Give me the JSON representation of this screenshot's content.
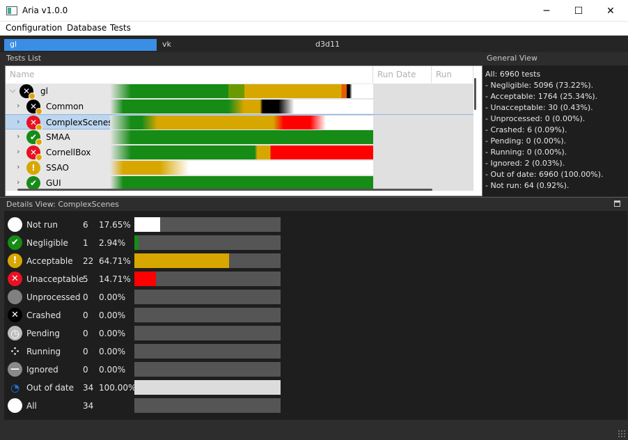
{
  "window": {
    "title": "Aria v1.0.0",
    "controls": {
      "minimize": "─",
      "maximize": "☐",
      "close": "✕"
    }
  },
  "menu": {
    "items": [
      "Configuration",
      "Database",
      "Tests"
    ]
  },
  "backends": {
    "tabs": [
      "gl",
      "vk",
      "d3d11"
    ],
    "active": "gl"
  },
  "tests_list": {
    "section_label": "Tests List",
    "columns": [
      "Name",
      "Run Date",
      "Run Time"
    ],
    "rows": [
      {
        "name": "gl",
        "expanded": true,
        "arrow": "⌵",
        "status_icon": "crashed-icon",
        "badge": "pending-badge",
        "bar": [
          [
            "#168b16",
            0.08,
            0.45
          ],
          [
            "#6a9a00",
            0.45,
            0.51
          ],
          [
            "#d7a700",
            0.51,
            0.88
          ],
          [
            "#e65c00",
            0.88,
            0.9
          ],
          [
            "#000000",
            0.9,
            0.91
          ],
          [
            "#ffffff",
            0.92,
            1.0
          ]
        ]
      },
      {
        "name": "Common",
        "expanded": false,
        "arrow": "›",
        "status_icon": "crashed-icon",
        "badge": "pending-badge",
        "bar": [
          [
            "#168b16",
            0.05,
            0.45
          ],
          [
            "#d7a700",
            0.51,
            0.57
          ],
          [
            "#000000",
            0.58,
            0.64
          ],
          [
            "#ffffff",
            0.7,
            1.0
          ]
        ]
      },
      {
        "name": "ComplexScenes",
        "expanded": false,
        "arrow": "›",
        "status_icon": "unacceptable-icon",
        "badge": "pending-badge",
        "selected": true,
        "bar": [
          [
            "#168b16",
            0.08,
            0.12
          ],
          [
            "#d7a700",
            0.18,
            0.62
          ],
          [
            "#ff0000",
            0.66,
            0.76
          ],
          [
            "#ffffff",
            0.82,
            1.0
          ]
        ]
      },
      {
        "name": "SMAA",
        "expanded": false,
        "arrow": "›",
        "status_icon": "negligible-icon",
        "badge": "pending-badge",
        "bar": [
          [
            "#168b16",
            0.08,
            1.0
          ]
        ]
      },
      {
        "name": "CornellBox",
        "expanded": false,
        "arrow": "›",
        "status_icon": "unacceptable-icon",
        "badge": "pending-badge",
        "bar": [
          [
            "#168b16",
            0.08,
            0.55
          ],
          [
            "#d7a700",
            0.56,
            0.61
          ],
          [
            "#ff0000",
            0.61,
            1.0
          ]
        ]
      },
      {
        "name": "SSAO",
        "expanded": false,
        "arrow": "›",
        "status_icon": "acceptable-icon",
        "badge": "",
        "bar": [
          [
            "#d7a700",
            0.05,
            0.19
          ],
          [
            "#ffffff",
            0.3,
            1.0
          ]
        ]
      },
      {
        "name": "GUI",
        "expanded": false,
        "arrow": "›",
        "status_icon": "negligible-icon",
        "badge": "",
        "bar": [
          [
            "#168b16",
            0.05,
            1.0
          ]
        ]
      }
    ]
  },
  "general_view": {
    "section_label": "General View",
    "lines": [
      "All: 6960 tests",
      "- Negligible: 5096 (73.22%).",
      "- Acceptable: 1764 (25.34%).",
      "- Unacceptable: 30 (0.43%).",
      "- Unprocessed: 0 (0.00%).",
      "- Crashed: 6 (0.09%).",
      "- Pending: 0 (0.00%).",
      "- Running: 0 (0.00%).",
      "- Ignored: 2 (0.03%).",
      "- Out of date: 6960 (100.00%).",
      "- Not run: 64 (0.92%)."
    ]
  },
  "details": {
    "section_label": "Details View: ComplexScenes",
    "rows": [
      {
        "label": "Not run",
        "count": "6",
        "pct": "17.65%",
        "fraction": 0.1765,
        "fill": "#ffffff",
        "icon": "not-run-icon",
        "icon_bg": "#ffffff",
        "glyph": ""
      },
      {
        "label": "Negligible",
        "count": "1",
        "pct": "2.94%",
        "fraction": 0.0294,
        "fill": "#168b16",
        "icon": "negligible-icon",
        "icon_bg": "#168b16",
        "glyph": "✔"
      },
      {
        "label": "Acceptable",
        "count": "22",
        "pct": "64.71%",
        "fraction": 0.6471,
        "fill": "#d7a700",
        "icon": "acceptable-icon",
        "icon_bg": "#d7a700",
        "glyph": "!"
      },
      {
        "label": "Unacceptable",
        "count": "5",
        "pct": "14.71%",
        "fraction": 0.1471,
        "fill": "#ff0000",
        "icon": "unacceptable-icon",
        "icon_bg": "#e81123",
        "glyph": "✕"
      },
      {
        "label": "Unprocessed",
        "count": "0",
        "pct": "0.00%",
        "fraction": 0,
        "fill": "#888888",
        "icon": "unprocessed-icon",
        "icon_bg": "#808080",
        "glyph": ""
      },
      {
        "label": "Crashed",
        "count": "0",
        "pct": "0.00%",
        "fraction": 0,
        "fill": "#000000",
        "icon": "crashed-icon",
        "icon_bg": "#000000",
        "glyph": "✕"
      },
      {
        "label": "Pending",
        "count": "0",
        "pct": "0.00%",
        "fraction": 0,
        "fill": "#cccccc",
        "icon": "pending-clock-icon",
        "icon_bg": "#bdbdbd",
        "glyph": "◷"
      },
      {
        "label": "Running",
        "count": "0",
        "pct": "0.00%",
        "fraction": 0,
        "fill": "#cccccc",
        "icon": "running-spinner-icon",
        "icon_bg": "#1e1e1e",
        "glyph": "⁘"
      },
      {
        "label": "Ignored",
        "count": "0",
        "pct": "0.00%",
        "fraction": 0,
        "fill": "#999999",
        "icon": "ignored-icon",
        "icon_bg": "#8a8a8a",
        "glyph": "—"
      },
      {
        "label": "Out of date",
        "count": "34",
        "pct": "100.00%",
        "fraction": 1.0,
        "fill": "#dcdcdc",
        "icon": "out-of-date-icon",
        "icon_bg": "#1e1e1e",
        "glyph": "◔"
      },
      {
        "label": "All",
        "count": "34",
        "pct": "",
        "fraction": 0,
        "fill": "#ffffff",
        "icon": "all-icon",
        "icon_bg": "#ffffff",
        "glyph": ""
      }
    ]
  }
}
